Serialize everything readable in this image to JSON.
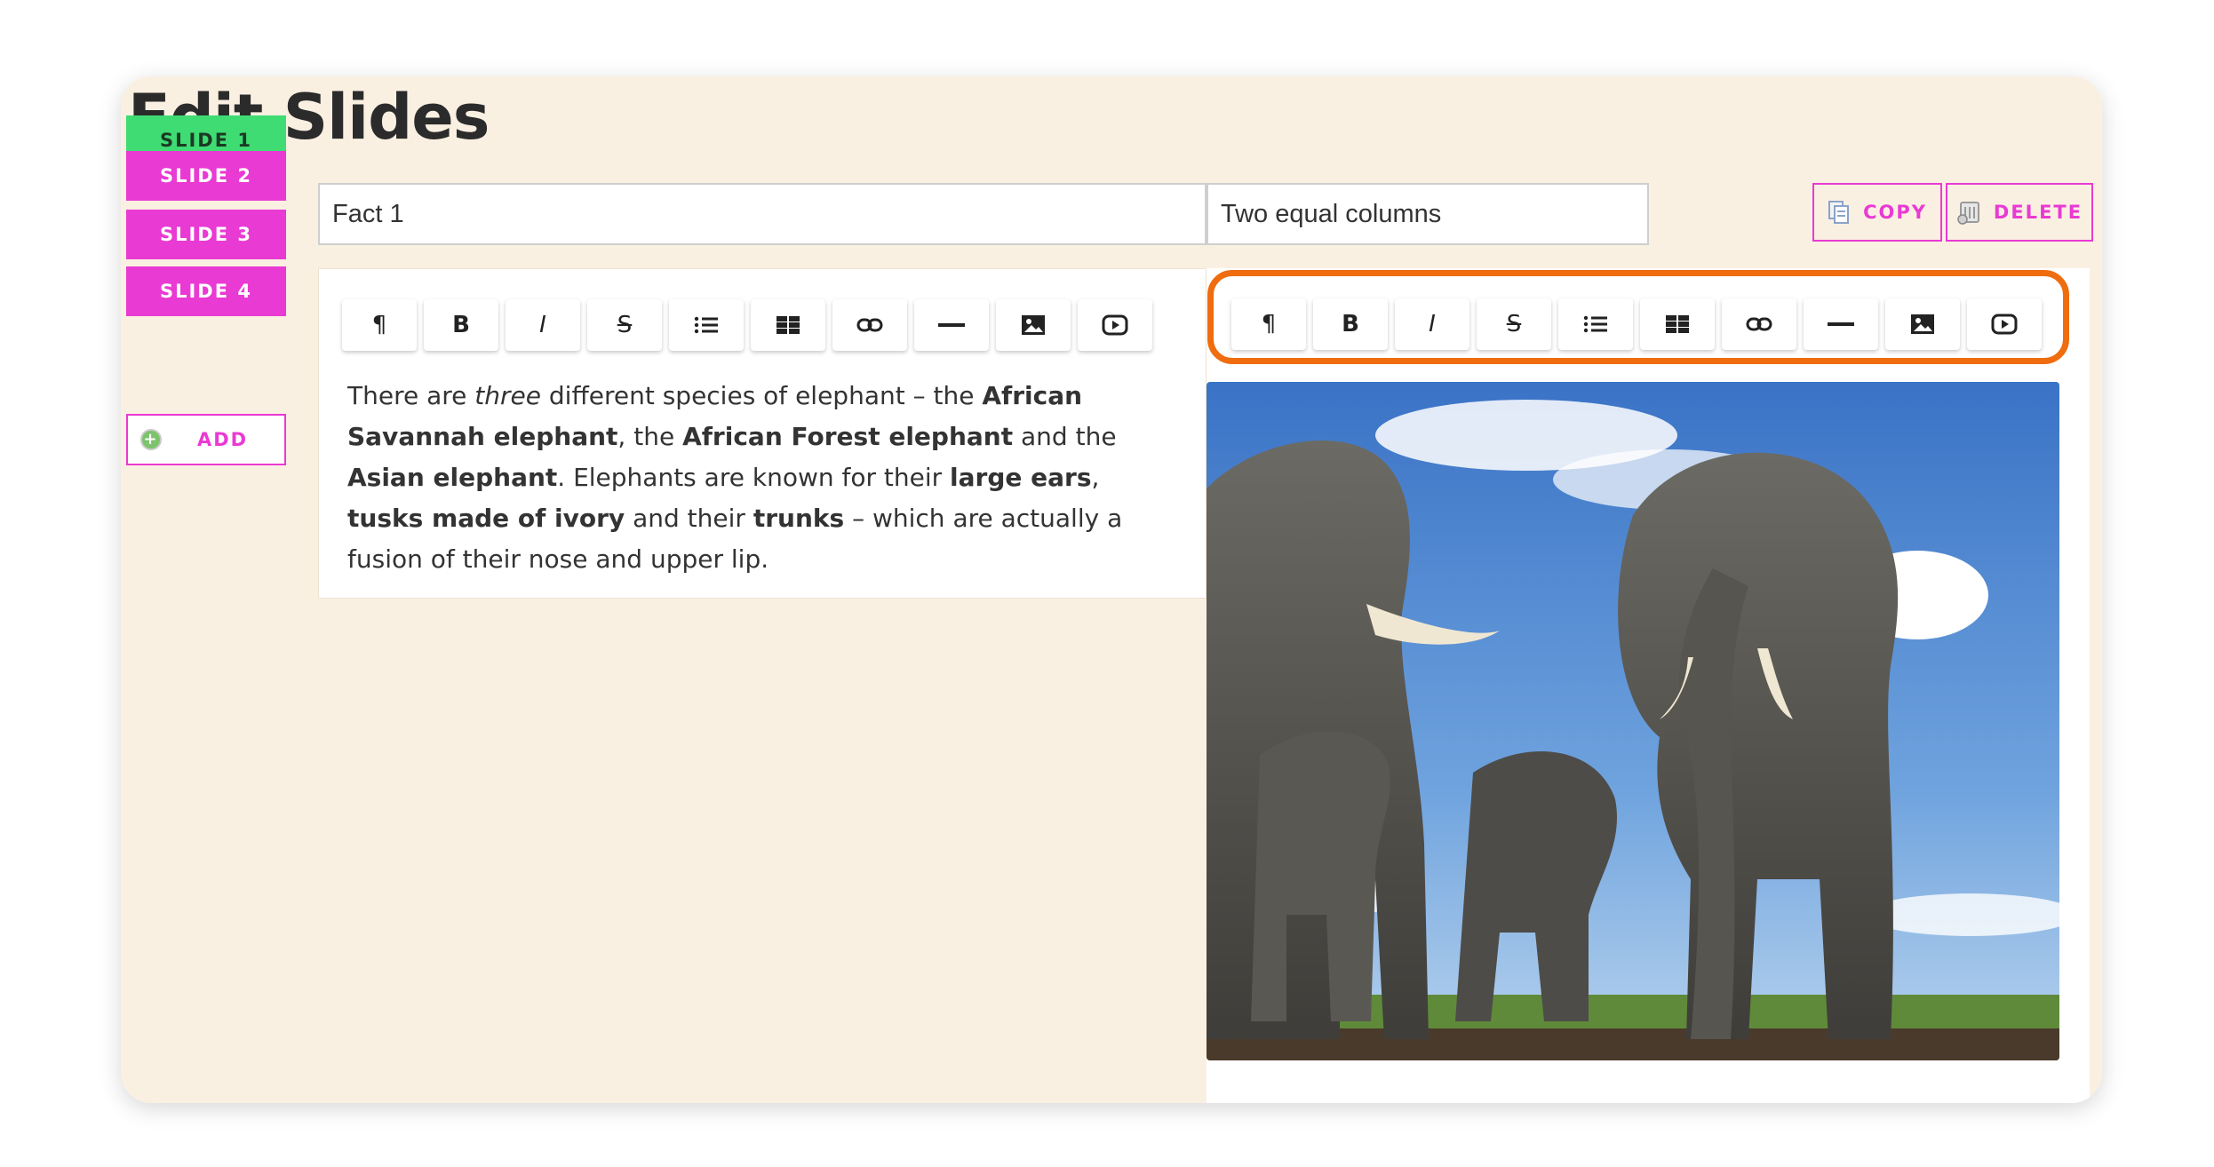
{
  "page": {
    "title": "Edit Slides"
  },
  "slides": [
    {
      "label": "SLIDE 1",
      "active": true
    },
    {
      "label": "SLIDE 2",
      "active": false
    },
    {
      "label": "SLIDE 3",
      "active": false
    },
    {
      "label": "SLIDE 4",
      "active": false
    }
  ],
  "add_button": {
    "label": "ADD"
  },
  "slide_title_input": {
    "value": "Fact 1"
  },
  "layout_input": {
    "value": "Two equal columns"
  },
  "actions": {
    "copy_label": "COPY",
    "delete_label": "DELETE"
  },
  "toolbar_icons": [
    "paragraph-icon",
    "bold-icon",
    "italic-icon",
    "strikethrough-icon",
    "bullet-list-icon",
    "table-icon",
    "link-icon",
    "horizontal-rule-icon",
    "image-icon",
    "video-icon"
  ],
  "editor": {
    "segments": [
      {
        "t": "There are ",
        "s": ""
      },
      {
        "t": "three",
        "s": "i"
      },
      {
        "t": " different species of elephant – the ",
        "s": ""
      },
      {
        "t": "African Savannah elephant",
        "s": "b"
      },
      {
        "t": ", the ",
        "s": ""
      },
      {
        "t": "African Forest elephant",
        "s": "b"
      },
      {
        "t": " and the ",
        "s": ""
      },
      {
        "t": "Asian elephant",
        "s": "b"
      },
      {
        "t": ". Elephants are known for their ",
        "s": ""
      },
      {
        "t": "large ears",
        "s": "b"
      },
      {
        "t": ", ",
        "s": ""
      },
      {
        "t": "tusks made of ivory",
        "s": "b"
      },
      {
        "t": " and their ",
        "s": ""
      },
      {
        "t": "trunks",
        "s": "b"
      },
      {
        "t": " – which are actually a fusion of their nose and upper lip.",
        "s": ""
      }
    ]
  },
  "colors": {
    "active_slide": "#3fdc74",
    "slide": "#e93ad3",
    "highlight": "#ef6c0f",
    "panel": "#faf0e2"
  }
}
